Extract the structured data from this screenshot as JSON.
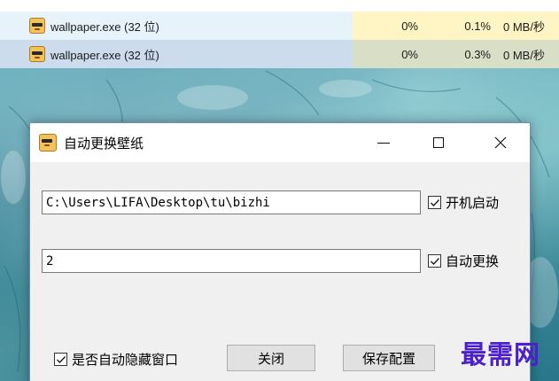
{
  "taskmanager": {
    "rows": [
      {
        "name": "wallpaper.exe (32 位)",
        "cpu": "0%",
        "memory": "0.1%",
        "disk": "0 MB/秒"
      },
      {
        "name": "wallpaper.exe (32 位)",
        "cpu": "0%",
        "memory": "0.3%",
        "disk": "0 MB/秒"
      }
    ]
  },
  "dialog": {
    "title": "自动更换壁纸",
    "icon": "sunglasses-face-icon",
    "path_value": "C:\\Users\\LIFA\\Desktop\\tu\\bizhi",
    "interval_value": "2",
    "autostart_label": "开机启动",
    "autostart_checked": true,
    "autochange_label": "自动更换",
    "autochange_checked": true,
    "autohide_label": "是否自动隐藏窗口",
    "autohide_checked": true,
    "close_button_label": "关闭",
    "save_button_label": "保存配置"
  },
  "watermark": "最需网",
  "colors": {
    "row1_bg": "#e6f3fb",
    "row2_bg": "#ccdcec",
    "cell_highlight": "#fff4c4",
    "watermark": "#4b1fc9"
  }
}
